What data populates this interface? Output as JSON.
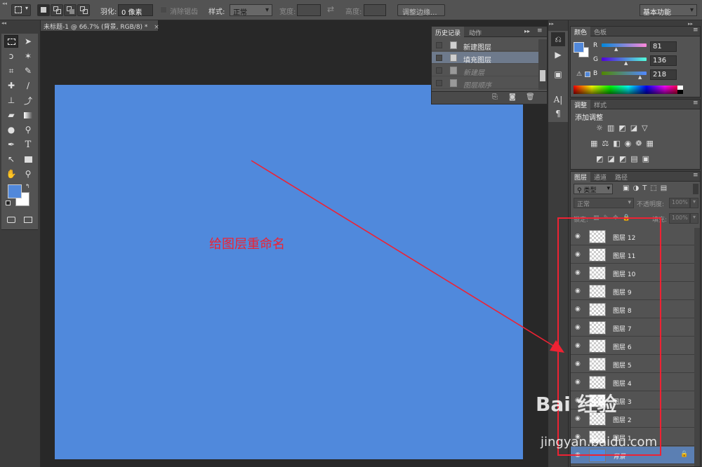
{
  "options_bar": {
    "feather_label": "羽化:",
    "feather_value": "0 像素",
    "anti_alias": "消除锯齿",
    "style_label": "样式:",
    "style_value": "正常",
    "width_label": "宽度:",
    "height_label": "高度:",
    "refine_edge_button": "调整边缘...",
    "workspace_value": "基本功能"
  },
  "document": {
    "tab_title": "未标题-1 @ 66.7% (背景, RGB/8) *",
    "canvas_color": "#5089dc"
  },
  "annotation": {
    "text": "给图层重命名",
    "color": "#ee2233"
  },
  "history_panel": {
    "tabs": [
      "历史记录",
      "动作"
    ],
    "items": [
      {
        "label": "新建图层",
        "state": "normal"
      },
      {
        "label": "填充图层",
        "state": "current"
      },
      {
        "label": "新建层",
        "state": "undone"
      },
      {
        "label": "图层顺序",
        "state": "undone"
      }
    ]
  },
  "color_panel": {
    "tabs": [
      "颜色",
      "色板"
    ],
    "r_label": "R",
    "g_label": "G",
    "b_label": "B",
    "r": "81",
    "g": "136",
    "b": "218",
    "foreground": "#5188da"
  },
  "adjustments_panel": {
    "tabs": [
      "调整",
      "样式"
    ],
    "title": "添加调整"
  },
  "layers_panel": {
    "tabs": [
      "图层",
      "通道",
      "路径"
    ],
    "filter_label": "类型",
    "blend_mode": "正常",
    "opacity_label": "不透明度:",
    "opacity_value": "100%",
    "lock_label": "锁定:",
    "fill_label": "填充:",
    "fill_value": "100%",
    "layers": [
      {
        "name": "图层 12"
      },
      {
        "name": "图层 11"
      },
      {
        "name": "图层 10"
      },
      {
        "name": "图层 9"
      },
      {
        "name": "图层 8"
      },
      {
        "name": "图层 7"
      },
      {
        "name": "图层 6"
      },
      {
        "name": "图层 5"
      },
      {
        "name": "图层 4"
      },
      {
        "name": "图层 3"
      },
      {
        "name": "图层 2"
      },
      {
        "name": "图层 1"
      },
      {
        "name": "背景"
      }
    ]
  },
  "watermark": {
    "brand": "Bai 经验",
    "url": "jingyan.baidu.com"
  }
}
